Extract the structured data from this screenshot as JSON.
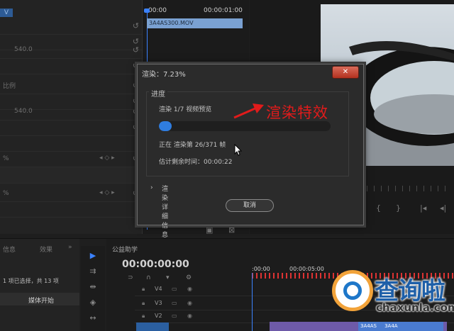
{
  "effect_controls": {
    "tab_label": "V",
    "rows": [
      {
        "value": "",
        "label": ""
      },
      {
        "value": "",
        "label": ""
      },
      {
        "value": "540.0",
        "label": ""
      },
      {
        "value": "",
        "label": ""
      },
      {
        "value": "",
        "label": "比例"
      },
      {
        "value": "",
        "label": ""
      },
      {
        "value": "540.0",
        "label": ""
      },
      {
        "value": "",
        "label": ""
      },
      {
        "value": "",
        "label": ""
      },
      {
        "value": "%",
        "label": ""
      },
      {
        "value": "",
        "label": ""
      },
      {
        "value": "%",
        "label": ""
      }
    ],
    "keyframe_value": "0"
  },
  "mini_timeline": {
    "start_time": "00:00",
    "end_time": "00:00:01:00",
    "clip_name": "3A4AS300.MOV"
  },
  "dialog": {
    "title": "渲染：7.23%",
    "close_icon": "close-x-icon",
    "group_label": "进度",
    "step_text": "渲染 1/7 视频预览",
    "frame_text": "正在 渲染第 26/371 帧",
    "remaining_text": "估计剩余时间：00:00:22",
    "details_label": "渲染详细信息",
    "cancel_label": "取消",
    "progress_fraction": 0.07
  },
  "annotation": {
    "text": "渲染特效",
    "color": "#e11b1b"
  },
  "bottom": {
    "project_tab_1": "信息",
    "project_tab_2": "效果",
    "selection_text": "1 项已选择，共 13 项",
    "column_header": "媒体开始",
    "sequence_name": "公益助学",
    "timecode": "00:00:00:00",
    "ruler_start": ":00:00",
    "ruler_mid": "00:00:05:00",
    "tracks": [
      "V4",
      "V3",
      "V2"
    ],
    "clip_label_1": "3A4AS",
    "clip_label_2": "3A4A"
  },
  "watermark": {
    "title": "查询啦",
    "subtitle": "chaxunla.com"
  },
  "colors": {
    "accent_blue": "#2f7de0",
    "annotation_red": "#e11b1b"
  }
}
